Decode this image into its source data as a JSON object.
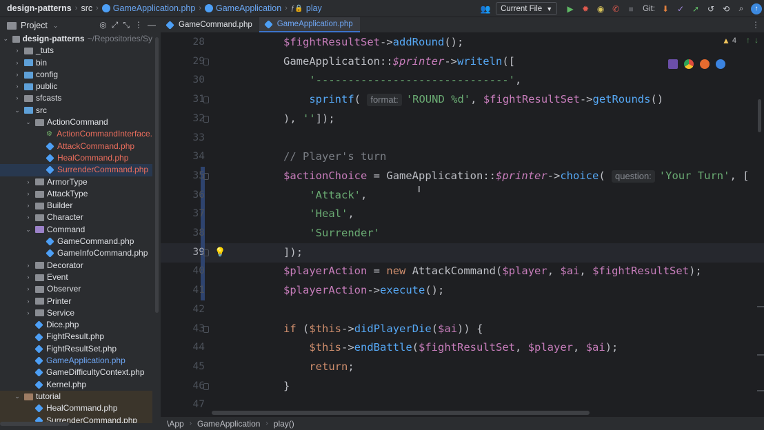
{
  "breadcrumb": {
    "project": "design-patterns",
    "folder": "src",
    "file": "GameApplication.php",
    "class": "GameApplication",
    "method": "play"
  },
  "toolbar": {
    "run_config": "Current File",
    "git_label": "Git:"
  },
  "project_panel": {
    "title": "Project",
    "root_name": "design-patterns",
    "root_path": "~/Repositories/Sy"
  },
  "tree": [
    {
      "label": "_tuts",
      "depth": 1,
      "kind": "folder",
      "arrow": "›"
    },
    {
      "label": "bin",
      "depth": 1,
      "kind": "folder-blue",
      "arrow": "›"
    },
    {
      "label": "config",
      "depth": 1,
      "kind": "folder-blue",
      "arrow": "›"
    },
    {
      "label": "public",
      "depth": 1,
      "kind": "folder-blue",
      "arrow": "›"
    },
    {
      "label": "sfcasts",
      "depth": 1,
      "kind": "folder",
      "arrow": "›"
    },
    {
      "label": "src",
      "depth": 1,
      "kind": "folder-blue",
      "arrow": "⌄"
    },
    {
      "label": "ActionCommand",
      "depth": 2,
      "kind": "folder",
      "arrow": "⌄"
    },
    {
      "label": "ActionCommandInterface.",
      "depth": 3,
      "kind": "interface",
      "color": "red"
    },
    {
      "label": "AttackCommand.php",
      "depth": 3,
      "kind": "php",
      "color": "red"
    },
    {
      "label": "HealCommand.php",
      "depth": 3,
      "kind": "php",
      "color": "red"
    },
    {
      "label": "SurrenderCommand.php",
      "depth": 3,
      "kind": "php",
      "color": "red",
      "selected": true
    },
    {
      "label": "ArmorType",
      "depth": 2,
      "kind": "folder",
      "arrow": "›"
    },
    {
      "label": "AttackType",
      "depth": 2,
      "kind": "folder",
      "arrow": "›"
    },
    {
      "label": "Builder",
      "depth": 2,
      "kind": "folder",
      "arrow": "›"
    },
    {
      "label": "Character",
      "depth": 2,
      "kind": "folder",
      "arrow": "›"
    },
    {
      "label": "Command",
      "depth": 2,
      "kind": "folder-purp",
      "arrow": "⌄"
    },
    {
      "label": "GameCommand.php",
      "depth": 3,
      "kind": "php"
    },
    {
      "label": "GameInfoCommand.php",
      "depth": 3,
      "kind": "php"
    },
    {
      "label": "Decorator",
      "depth": 2,
      "kind": "folder",
      "arrow": "›"
    },
    {
      "label": "Event",
      "depth": 2,
      "kind": "folder",
      "arrow": "›"
    },
    {
      "label": "Observer",
      "depth": 2,
      "kind": "folder",
      "arrow": "›"
    },
    {
      "label": "Printer",
      "depth": 2,
      "kind": "folder",
      "arrow": "›"
    },
    {
      "label": "Service",
      "depth": 2,
      "kind": "folder",
      "arrow": "›"
    },
    {
      "label": "Dice.php",
      "depth": 2,
      "kind": "php"
    },
    {
      "label": "FightResult.php",
      "depth": 2,
      "kind": "php"
    },
    {
      "label": "FightResultSet.php",
      "depth": 2,
      "kind": "php"
    },
    {
      "label": "GameApplication.php",
      "depth": 2,
      "kind": "php",
      "color": "blue"
    },
    {
      "label": "GameDifficultyContext.php",
      "depth": 2,
      "kind": "php"
    },
    {
      "label": "Kernel.php",
      "depth": 2,
      "kind": "php"
    },
    {
      "label": "tutorial",
      "depth": 1,
      "kind": "folder-brown",
      "arrow": "⌄",
      "tut": true
    },
    {
      "label": "HealCommand.php",
      "depth": 2,
      "kind": "php",
      "tut": true
    },
    {
      "label": "SurrenderCommand.php",
      "depth": 2,
      "kind": "php",
      "tut": true
    }
  ],
  "tabs": [
    {
      "label": "GameCommand.php",
      "active": false
    },
    {
      "label": "GameApplication.php",
      "active": true
    }
  ],
  "editor": {
    "warnings_count": "4",
    "current_line": 39,
    "line_numbers": [
      "28",
      "29",
      "30",
      "31",
      "32",
      "33",
      "34",
      "35",
      "36",
      "37",
      "38",
      "39",
      "40",
      "41",
      "42",
      "43",
      "44",
      "45",
      "46",
      "47"
    ],
    "code_lines": [
      "$fightResultSet->addRound();",
      "GameApplication::$printer->writeln([",
      "    '------------------------------',",
      "    sprintf( 'ROUND %d', $fightResultSet->getRounds()",
      "), '']);",
      "",
      "// Player's turn",
      "$actionChoice = GameApplication::$printer->choice( 'Your Turn', [",
      "    'Attack',",
      "    'Heal',",
      "    'Surrender'",
      "]);",
      "$playerAction = new AttackCommand($player, $ai, $fightResultSet);",
      "$playerAction->execute();",
      "",
      "if ($this->didPlayerDie($ai)) {",
      "    $this->endBattle($fightResultSet, $player, $ai);",
      "    return;",
      "}",
      ""
    ],
    "hint_format": "format:",
    "hint_question": "question:"
  },
  "statusbar": {
    "namespace": "\\App",
    "class": "GameApplication",
    "method": "play()"
  }
}
